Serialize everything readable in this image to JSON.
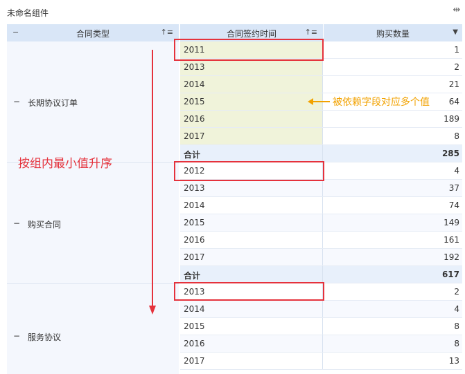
{
  "component_title": "未命名组件",
  "header": {
    "col1": "合同类型",
    "col2": "合同签约时间",
    "col3": "购买数量",
    "collapse_glyph": "−",
    "sort_icon": "sort-asc-icon",
    "dropdown_icon": "dropdown-arrow-icon"
  },
  "groups": [
    {
      "name": "长期协议订单",
      "rows": [
        {
          "year": "2011",
          "count": "1"
        },
        {
          "year": "2013",
          "count": "2"
        },
        {
          "year": "2014",
          "count": "21"
        },
        {
          "year": "2015",
          "count": "64"
        },
        {
          "year": "2016",
          "count": "189"
        },
        {
          "year": "2017",
          "count": "8"
        }
      ],
      "total_label": "合计",
      "total": "285"
    },
    {
      "name": "购买合同",
      "rows": [
        {
          "year": "2012",
          "count": "4"
        },
        {
          "year": "2013",
          "count": "37"
        },
        {
          "year": "2014",
          "count": "74"
        },
        {
          "year": "2015",
          "count": "149"
        },
        {
          "year": "2016",
          "count": "161"
        },
        {
          "year": "2017",
          "count": "192"
        }
      ],
      "total_label": "合计",
      "total": "617"
    },
    {
      "name": "服务协议",
      "rows": [
        {
          "year": "2013",
          "count": "2"
        },
        {
          "year": "2014",
          "count": "4"
        },
        {
          "year": "2015",
          "count": "8"
        },
        {
          "year": "2016",
          "count": "8"
        },
        {
          "year": "2017",
          "count": "13"
        }
      ]
    }
  ],
  "annotations": {
    "sort_note": "按组内最小值升序",
    "multi_value_note": "被依赖字段对应多个值"
  },
  "colors": {
    "header_bg": "#d9e6f7",
    "highlight_bg": "#f0f3da",
    "annotation_red": "#e5323c",
    "annotation_orange": "#f2a200"
  }
}
